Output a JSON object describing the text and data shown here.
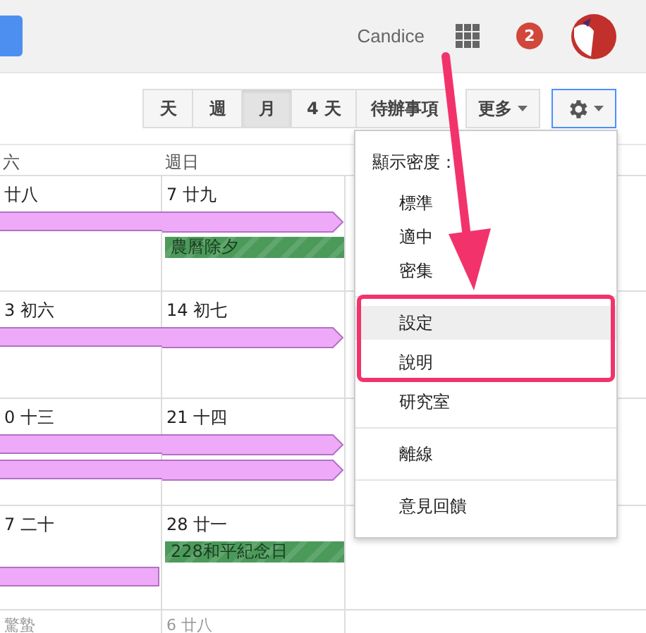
{
  "header": {
    "user_name": "Candice",
    "notification_count": "2"
  },
  "view_buttons": [
    {
      "label": "天",
      "selected": false
    },
    {
      "label": "週",
      "selected": false
    },
    {
      "label": "月",
      "selected": true
    },
    {
      "label": "4 天",
      "selected": false
    },
    {
      "label": "待辦事項",
      "selected": false
    }
  ],
  "more_button": {
    "label": "更多"
  },
  "calendar": {
    "columns": [
      "六",
      "週日"
    ],
    "weeks": [
      {
        "dates": [
          "廿八",
          "7 廿九"
        ],
        "lanes": [
          [
            {
              "kind": "span",
              "color": "#eeaaf8",
              "continues": true
            },
            {
              "kind": "span",
              "color": "#eeaaf8",
              "continues": true
            }
          ],
          [
            {
              "kind": "none"
            },
            {
              "kind": "event",
              "text": "農曆除夕",
              "color": "#4b9a5a"
            }
          ]
        ]
      },
      {
        "dates": [
          "3 初六",
          "14 初七"
        ],
        "lanes": [
          [
            {
              "kind": "span",
              "color": "#eeaaf8",
              "continues": true
            },
            {
              "kind": "span",
              "color": "#eeaaf8",
              "continues": true
            }
          ]
        ]
      },
      {
        "dates": [
          "0 十三",
          "21 十四"
        ],
        "lanes": [
          [
            {
              "kind": "span",
              "color": "#eeaaf8",
              "continues": true
            },
            {
              "kind": "span",
              "color": "#eeaaf8",
              "continues": true
            }
          ],
          [
            {
              "kind": "span",
              "color": "#eeaaf8",
              "continues": true
            },
            {
              "kind": "span",
              "color": "#eeaaf8",
              "continues": true
            }
          ]
        ]
      },
      {
        "dates": [
          "7 二十",
          "28 廿一"
        ],
        "lanes": [
          [
            {
              "kind": "none"
            },
            {
              "kind": "event",
              "text": "228和平紀念日",
              "color": "#4b9a5a"
            }
          ],
          [
            {
              "kind": "span",
              "color": "#eeaaf8",
              "continues": false
            },
            {
              "kind": "none"
            }
          ]
        ]
      },
      {
        "dates": [
          "驚蟄",
          "6 廿八"
        ]
      }
    ]
  },
  "settings_menu": {
    "items": [
      {
        "kind": "header",
        "label": "顯示密度："
      },
      {
        "kind": "sub",
        "label": "標準",
        "selected": false
      },
      {
        "kind": "sub",
        "label": "適中",
        "selected": false
      },
      {
        "kind": "sub",
        "label": "密集",
        "selected": false
      },
      {
        "kind": "separator"
      },
      {
        "kind": "item",
        "label": "設定",
        "selected": true
      },
      {
        "kind": "item",
        "label": "說明",
        "selected": false
      },
      {
        "kind": "item",
        "label": "研究室",
        "selected": false
      },
      {
        "kind": "separator"
      },
      {
        "kind": "item",
        "label": "離線",
        "selected": false
      },
      {
        "kind": "separator"
      },
      {
        "kind": "item",
        "label": "意見回饋",
        "selected": false
      }
    ]
  }
}
